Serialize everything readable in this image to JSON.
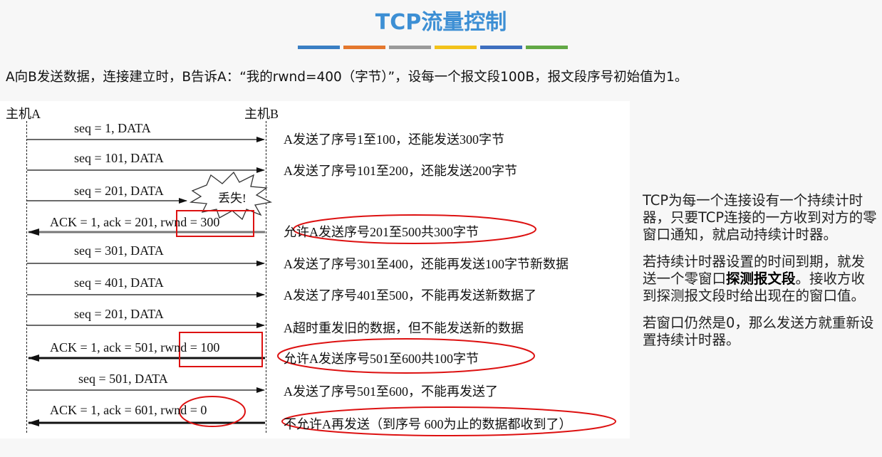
{
  "title": "TCP流量控制",
  "color_bars": [
    "#3a7fc4",
    "#e4782e",
    "#9a9a9a",
    "#f2c21a",
    "#3e6fbf",
    "#62a845"
  ],
  "intro": "A向B发送数据，连接建立时，B告诉A：“我的rwnd=400（字节）”，设每一个报文段100B，报文段序号初始值为1。",
  "host_a": "主机A",
  "host_b": "主机B",
  "messages": [
    {
      "label": "seq = 1, DATA",
      "note": "A发送了序号1至100，还能发送300字节"
    },
    {
      "label": "seq = 101, DATA",
      "note": "A发送了序号101至200，还能发送200字节"
    },
    {
      "label": "seq = 201, DATA",
      "note": ""
    },
    {
      "label": "ACK = 1, ack = 201, rwnd = 300",
      "note": "允许A发送序号201至500共300字节"
    },
    {
      "label": "seq = 301, DATA",
      "note": "A发送了序号301至400，还能再发送100字节新数据"
    },
    {
      "label": "seq = 401, DATA",
      "note": "A发送了序号401至500，不能再发送新数据了"
    },
    {
      "label": "seq = 201, DATA",
      "note": "A超时重发旧的数据，但不能发送新的数据"
    },
    {
      "label": "ACK = 1, ack = 501, rwnd = 100",
      "note": "允许A发送序号501至600共100字节"
    },
    {
      "label": "seq = 501, DATA",
      "note": "A发送了序号501至600，不能再发送了"
    },
    {
      "label": "ACK = 1, ack = 601, rwnd = 0",
      "note": "不允许A再发送（到序号 600为止的数据都收到了）"
    }
  ],
  "lost_label": "丢失!",
  "side": {
    "p1": "TCP为每一个连接设有一个持续计时器，只要TCP连接的一方收到对方的零窗口通知，就启动持续计时器。",
    "p2_a": "若持续计时器设置的时间到期，就发送一个零窗口",
    "p2_bold": "探测报文段",
    "p2_b": "。接收方收到探测报文段时给出现在的窗口值。",
    "p3": "若窗口仍然是0，那么发送方就重新设置持续计时器。"
  }
}
